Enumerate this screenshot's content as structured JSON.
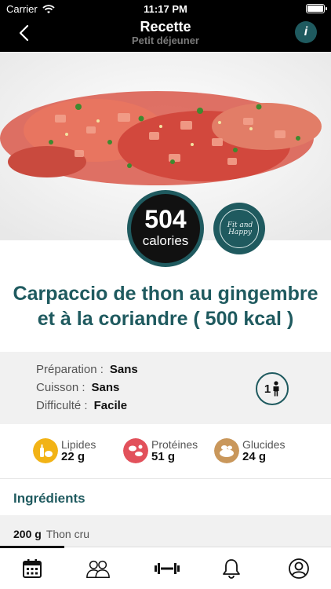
{
  "status": {
    "carrier": "Carrier",
    "time": "11:17 PM"
  },
  "nav": {
    "title": "Recette",
    "subtitle": "Petit déjeuner",
    "info_symbol": "i"
  },
  "calories": {
    "value": "504",
    "label": "calories"
  },
  "logo": {
    "text": "Fit and Happy"
  },
  "recipe": {
    "title": "Carpaccio de thon au gingembre et à la coriandre ( 500 kcal )"
  },
  "details": {
    "preparation_label": "Préparation :",
    "preparation_value": "Sans",
    "cuisson_label": "Cuisson :",
    "cuisson_value": "Sans",
    "difficulte_label": "Difficulté :",
    "difficulte_value": "Facile",
    "persons": "1"
  },
  "macros": [
    {
      "label": "Lipides",
      "value": "22 g",
      "color": "#f2b316"
    },
    {
      "label": "Protéines",
      "value": "51 g",
      "color": "#e2515b"
    },
    {
      "label": "Glucides",
      "value": "24 g",
      "color": "#c9975b"
    }
  ],
  "ingredients": {
    "title": "Ingrédients",
    "items": [
      {
        "quantity": "200 g",
        "name": "Thon cru"
      }
    ]
  },
  "tabs": [
    {
      "icon": "calendar-icon"
    },
    {
      "icon": "community-icon"
    },
    {
      "icon": "dumbbell-icon"
    },
    {
      "icon": "bell-icon"
    },
    {
      "icon": "profile-icon"
    }
  ],
  "colors": {
    "accent": "#1f5a5f",
    "header": "#000000"
  }
}
